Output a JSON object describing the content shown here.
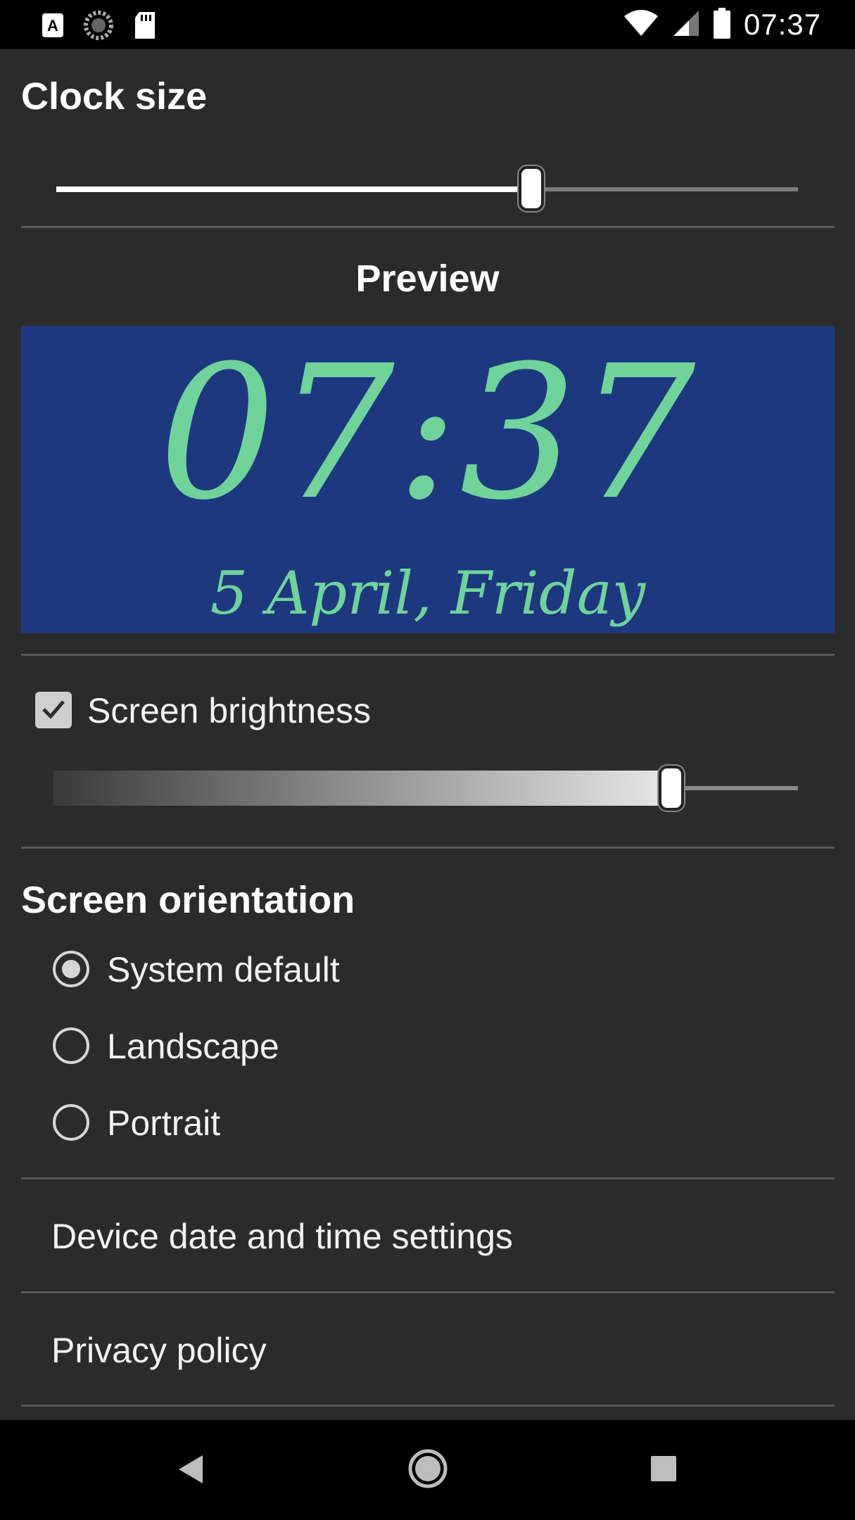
{
  "status_bar": {
    "time": "07:37",
    "icons": [
      "a-notification-icon",
      "sync-icon",
      "sd-card-icon",
      "wifi-icon",
      "signal-icon",
      "battery-icon"
    ]
  },
  "clock_size": {
    "title": "Clock size",
    "value_fraction": 0.64
  },
  "preview": {
    "title": "Preview",
    "time": "07:37",
    "date": "5 April, Friday",
    "background_color": "#1e3880",
    "text_color": "#6fd39a"
  },
  "brightness": {
    "label": "Screen brightness",
    "checked": true,
    "value_fraction": 0.82
  },
  "orientation": {
    "title": "Screen orientation",
    "options": [
      {
        "label": "System default",
        "selected": true
      },
      {
        "label": "Landscape",
        "selected": false
      },
      {
        "label": "Portrait",
        "selected": false
      }
    ]
  },
  "links": {
    "date_time_settings": "Device date and time settings",
    "privacy_policy": "Privacy policy"
  },
  "nav_bar": {
    "icons": [
      "back-icon",
      "home-icon",
      "recents-icon"
    ]
  }
}
